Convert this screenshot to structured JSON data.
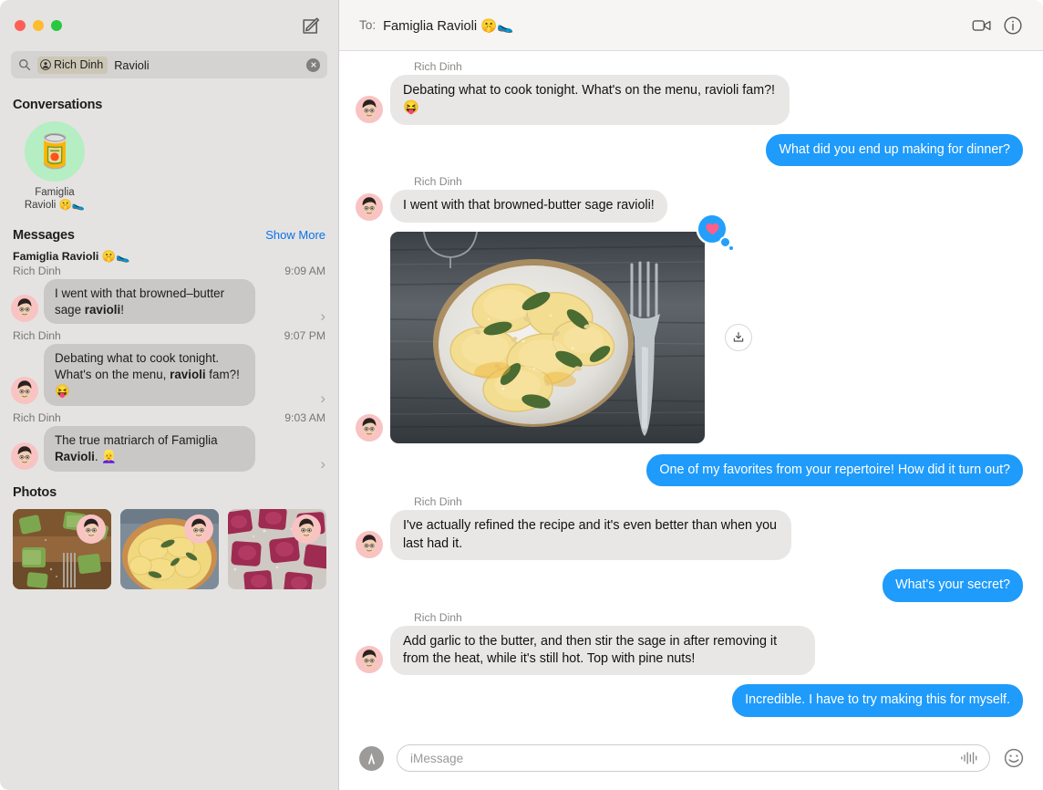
{
  "window": {
    "traffic_lights": [
      "close",
      "minimize",
      "maximize"
    ],
    "compose_icon": "compose-icon"
  },
  "sidebar": {
    "search": {
      "icon": "search-icon",
      "token_icon": "person-circle-icon",
      "token_label": "Rich Dinh",
      "query_text": "Ravioli",
      "clear_icon": "clear-icon",
      "placeholder": "Search"
    },
    "conversations": {
      "title": "Conversations",
      "items": [
        {
          "avatar_emoji": "🥫",
          "name_line1": "Famiglia",
          "name_line2": "Ravioli 🤫🥿",
          "avatar_bg": "#b5eec2"
        }
      ]
    },
    "messages": {
      "title": "Messages",
      "show_more": "Show More",
      "items": [
        {
          "group": "Famiglia Ravioli 🤫🥿",
          "sender": "Rich Dinh",
          "time": "9:09 AM",
          "text_before": "I went with that browned–butter sage ",
          "text_match": "ravioli",
          "text_after": "!",
          "chevron": "chevron-right-icon"
        },
        {
          "group": "",
          "sender": "Rich Dinh",
          "time": "9:07 PM",
          "text_before": "Debating what to cook tonight. What's on the menu, ",
          "text_match": "ravioli",
          "text_after": " fam?! 😝",
          "chevron": "chevron-right-icon"
        },
        {
          "group": "",
          "sender": "Rich Dinh",
          "time": "9:03 AM",
          "text_before": "The true matriarch of Famiglia ",
          "text_match": "Ravioli",
          "text_after": ". 👱‍♀️",
          "chevron": "chevron-right-icon"
        }
      ]
    },
    "photos": {
      "title": "Photos",
      "items": [
        {
          "alt": "green-spinach-ravioli-on-wood"
        },
        {
          "alt": "yellow-ravioli-with-sage-in-bowl"
        },
        {
          "alt": "pink-beet-ravioli-on-flour"
        }
      ]
    }
  },
  "conversation": {
    "header": {
      "to_label": "To:",
      "to_name": "Famiglia Ravioli 🤫🥿",
      "facetime_icon": "video-camera-icon",
      "info_icon": "info-circle-icon"
    },
    "messages": [
      {
        "type": "text",
        "direction": "in",
        "sender": "Rich Dinh",
        "text": "Debating what to cook tonight. What's on the menu, ravioli fam?! 😝"
      },
      {
        "type": "text",
        "direction": "out",
        "sender": "",
        "text": "What did you end up making for dinner?"
      },
      {
        "type": "text",
        "direction": "in",
        "sender": "Rich Dinh",
        "text": "I went with that browned-butter sage ravioli!"
      },
      {
        "type": "image",
        "direction": "in",
        "sender": "",
        "alt": "plate-of-ravioli-with-sage-on-wood-table",
        "tapback": "heart",
        "download_icon": "download-icon"
      },
      {
        "type": "text",
        "direction": "out",
        "sender": "",
        "text": "One of my favorites from your repertoire! How did it turn out?"
      },
      {
        "type": "text",
        "direction": "in",
        "sender": "Rich Dinh",
        "text": "I've actually refined the recipe and it's even better than when you last had it."
      },
      {
        "type": "text",
        "direction": "out",
        "sender": "",
        "text": "What's your secret?"
      },
      {
        "type": "text",
        "direction": "in",
        "sender": "Rich Dinh",
        "text": "Add garlic to the butter, and then stir the sage in after removing it from the heat, while it's still hot. Top with pine nuts!"
      },
      {
        "type": "text",
        "direction": "out",
        "sender": "",
        "text": "Incredible. I have to try making this for myself."
      }
    ],
    "composer": {
      "appstore_icon": "app-store-icon",
      "placeholder": "iMessage",
      "value": "",
      "audio_icon": "audio-waveform-icon",
      "emoji_icon": "smiley-face-icon"
    }
  },
  "colors": {
    "imessage_blue": "#1f9bfb",
    "bubble_gray": "#e8e7e6",
    "sidebar_bg": "#e4e3e2",
    "link_blue": "#0b72e7",
    "tapback_heart": "#fc5f8a",
    "avatar_pink": "#f8c3c2",
    "convo_avatar_green": "#b5eec2"
  }
}
